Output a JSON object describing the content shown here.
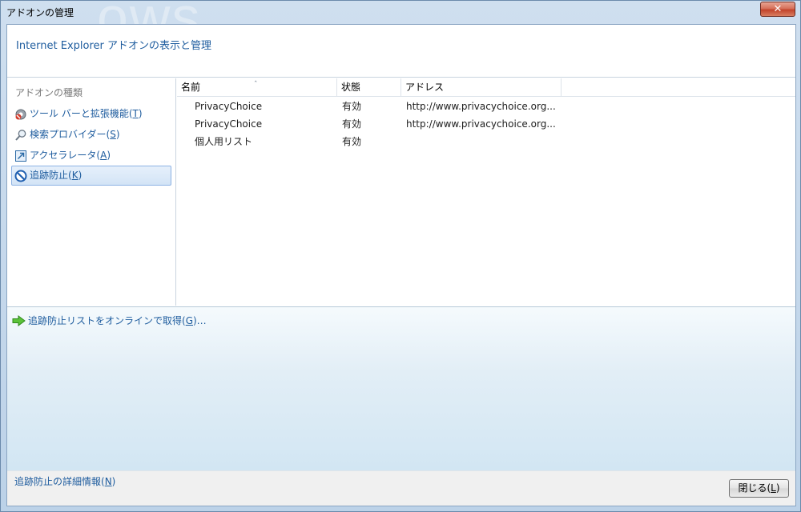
{
  "window": {
    "title": "アドオンの管理",
    "close_glyph": "✕"
  },
  "header": {
    "title": "Internet Explorer アドオンの表示と管理"
  },
  "categories": {
    "heading": "アドオンの種類",
    "items": [
      {
        "label_main": "ツール バーと拡張機能(",
        "accel": "T",
        "label_end": ")",
        "icon": "gear-icon",
        "selected": false
      },
      {
        "label_main": "検索プロバイダー(",
        "accel": "S",
        "label_end": ")",
        "icon": "magnifier-icon",
        "selected": false
      },
      {
        "label_main": "アクセラレータ(",
        "accel": "A",
        "label_end": ")",
        "icon": "accelerator-icon",
        "selected": false
      },
      {
        "label_main": "追跡防止(",
        "accel": "K",
        "label_end": ")",
        "icon": "tracking-protection-icon",
        "selected": true
      }
    ]
  },
  "list": {
    "columns": [
      "名前",
      "状態",
      "アドレス"
    ],
    "sort_indicator": "ˆ",
    "rows": [
      {
        "name": "PrivacyChoice",
        "status": "有効",
        "address": "http://www.privacychoice.org..."
      },
      {
        "name": "PrivacyChoice",
        "status": "有効",
        "address": "http://www.privacychoice.org..."
      },
      {
        "name": "個人用リスト",
        "status": "有効",
        "address": ""
      }
    ]
  },
  "bottom": {
    "get_list_main": "追跡防止リストをオンラインで取得(",
    "get_list_accel": "G",
    "get_list_end": ")…",
    "icon": "green-arrow-icon"
  },
  "footer": {
    "more_info_main": "追跡防止の詳細情報(",
    "more_info_accel": "N",
    "more_info_end": ")",
    "close_main": "閉じる(",
    "close_accel": "L",
    "close_end": ")"
  },
  "colors": {
    "link": "#1e5c9e",
    "selected_bg": "#d3e4f6",
    "selected_border": "#8db2e3"
  }
}
